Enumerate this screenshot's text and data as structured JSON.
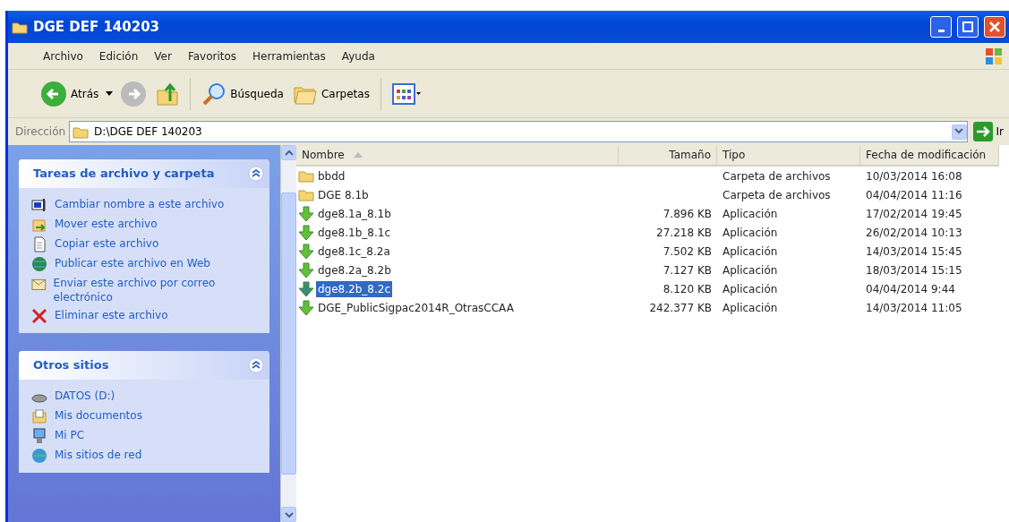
{
  "window": {
    "title": "DGE DEF 140203"
  },
  "menu": [
    "Archivo",
    "Edición",
    "Ver",
    "Favoritos",
    "Herramientas",
    "Ayuda"
  ],
  "toolbar": {
    "back": "Atrás",
    "search": "Búsqueda",
    "folders": "Carpetas"
  },
  "address": {
    "label": "Dirección",
    "value": "D:\\DGE DEF 140203",
    "go": "Ir"
  },
  "panels": [
    {
      "title": "Tareas de archivo y carpeta",
      "expanded": true,
      "items": [
        {
          "label": "Cambiar nombre a este archivo",
          "kind": "rename"
        },
        {
          "label": "Mover este archivo",
          "kind": "move"
        },
        {
          "label": "Copiar este archivo",
          "kind": "copy"
        },
        {
          "label": "Publicar este archivo en Web",
          "kind": "web"
        },
        {
          "label": "Enviar este archivo por correo electrónico",
          "kind": "mail"
        },
        {
          "label": "Eliminar este archivo",
          "kind": "delete"
        }
      ]
    },
    {
      "title": "Otros sitios",
      "expanded": true,
      "items": [
        {
          "label": "DATOS (D:)",
          "kind": "drive"
        },
        {
          "label": "Mis documentos",
          "kind": "docs"
        },
        {
          "label": "Mi PC",
          "kind": "pc"
        },
        {
          "label": "Mis sitios de red",
          "kind": "network"
        }
      ]
    }
  ],
  "table": {
    "columns": [
      "Nombre",
      "Tamaño",
      "Tipo",
      "Fecha de modificación"
    ],
    "rows": [
      {
        "name": "bbdd",
        "size": "",
        "type": "Carpeta de archivos",
        "date": "10/03/2014 16:08",
        "kind": "folder",
        "selected": false
      },
      {
        "name": "DGE 8.1b",
        "size": "",
        "type": "Carpeta de archivos",
        "date": "04/04/2014 11:16",
        "kind": "folder",
        "selected": false
      },
      {
        "name": "dge8.1a_8.1b",
        "size": "7.896 KB",
        "type": "Aplicación",
        "date": "17/02/2014 19:45",
        "kind": "app",
        "selected": false
      },
      {
        "name": "dge8.1b_8.1c",
        "size": "27.218 KB",
        "type": "Aplicación",
        "date": "26/02/2014 10:13",
        "kind": "app",
        "selected": false
      },
      {
        "name": "dge8.1c_8.2a",
        "size": "7.502 KB",
        "type": "Aplicación",
        "date": "14/03/2014 15:45",
        "kind": "app",
        "selected": false
      },
      {
        "name": "dge8.2a_8.2b",
        "size": "7.127 KB",
        "type": "Aplicación",
        "date": "18/03/2014 15:15",
        "kind": "app",
        "selected": false
      },
      {
        "name": "dge8.2b_8.2c",
        "size": "8.120 KB",
        "type": "Aplicación",
        "date": "04/04/2014 9:44",
        "kind": "app",
        "selected": true
      },
      {
        "name": "DGE_PublicSigpac2014R_OtrasCCAA",
        "size": "242.377 KB",
        "type": "Aplicación",
        "date": "14/03/2014 11:05",
        "kind": "app",
        "selected": false
      }
    ]
  }
}
